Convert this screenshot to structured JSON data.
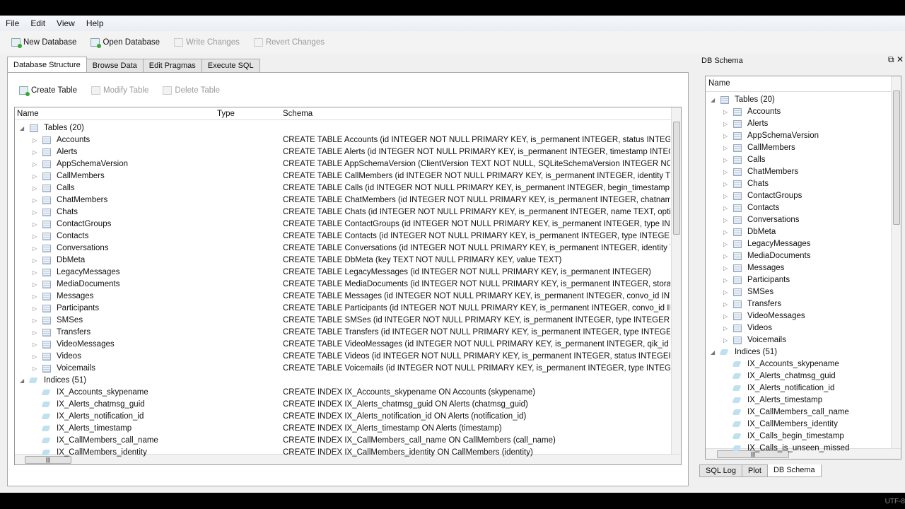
{
  "menu": [
    "File",
    "Edit",
    "View",
    "Help"
  ],
  "toolbar": {
    "new_db": "New Database",
    "open_db": "Open Database",
    "write": "Write Changes",
    "revert": "Revert Changes"
  },
  "tabs": [
    "Database Structure",
    "Browse Data",
    "Edit Pragmas",
    "Execute SQL"
  ],
  "subtoolbar": {
    "create": "Create Table",
    "modify": "Modify Table",
    "delete": "Delete Table"
  },
  "columns": {
    "name": "Name",
    "type": "Type",
    "schema": "Schema"
  },
  "tables_label": "Tables (20)",
  "indices_label": "Indices (51)",
  "tables": [
    {
      "name": "Accounts",
      "schema": "CREATE TABLE Accounts (id INTEGER NOT NULL PRIMARY KEY, is_permanent INTEGER, status INTEGER, pwdc"
    },
    {
      "name": "Alerts",
      "schema": "CREATE TABLE Alerts (id INTEGER NOT NULL PRIMARY KEY, is_permanent INTEGER, timestamp INTEGER, partr"
    },
    {
      "name": "AppSchemaVersion",
      "schema": "CREATE TABLE AppSchemaVersion (ClientVersion TEXT NOT NULL, SQLiteSchemaVersion INTEGER NOT NULL"
    },
    {
      "name": "CallMembers",
      "schema": "CREATE TABLE CallMembers (id INTEGER NOT NULL PRIMARY KEY, is_permanent INTEGER, identity TEXT, disp"
    },
    {
      "name": "Calls",
      "schema": "CREATE TABLE Calls (id INTEGER NOT NULL PRIMARY KEY, is_permanent INTEGER, begin_timestamp INTEGER"
    },
    {
      "name": "ChatMembers",
      "schema": "CREATE TABLE ChatMembers (id INTEGER NOT NULL PRIMARY KEY, is_permanent INTEGER, chatname TEXT, i"
    },
    {
      "name": "Chats",
      "schema": "CREATE TABLE Chats (id INTEGER NOT NULL PRIMARY KEY, is_permanent INTEGER, name TEXT, options INTE"
    },
    {
      "name": "ContactGroups",
      "schema": "CREATE TABLE ContactGroups (id INTEGER NOT NULL PRIMARY KEY, is_permanent INTEGER, type INTEGER, c"
    },
    {
      "name": "Contacts",
      "schema": "CREATE TABLE Contacts (id INTEGER NOT NULL PRIMARY KEY, is_permanent INTEGER, type INTEGER, skypena"
    },
    {
      "name": "Conversations",
      "schema": "CREATE TABLE Conversations (id INTEGER NOT NULL PRIMARY KEY, is_permanent INTEGER, identity TEXT, typ"
    },
    {
      "name": "DbMeta",
      "schema": "CREATE TABLE DbMeta (key TEXT NOT NULL PRIMARY KEY, value TEXT)"
    },
    {
      "name": "LegacyMessages",
      "schema": "CREATE TABLE LegacyMessages (id INTEGER NOT NULL PRIMARY KEY, is_permanent INTEGER)"
    },
    {
      "name": "MediaDocuments",
      "schema": "CREATE TABLE MediaDocuments (id INTEGER NOT NULL PRIMARY KEY, is_permanent INTEGER, storage_docu"
    },
    {
      "name": "Messages",
      "schema": "CREATE TABLE Messages (id INTEGER NOT NULL PRIMARY KEY, is_permanent INTEGER, convo_id INTEGER, ch"
    },
    {
      "name": "Participants",
      "schema": "CREATE TABLE Participants (id INTEGER NOT NULL PRIMARY KEY, is_permanent INTEGER, convo_id INTEGER,"
    },
    {
      "name": "SMSes",
      "schema": "CREATE TABLE SMSes (id INTEGER NOT NULL PRIMARY KEY, is_permanent INTEGER, type INTEGER, outgoing_"
    },
    {
      "name": "Transfers",
      "schema": "CREATE TABLE Transfers (id INTEGER NOT NULL PRIMARY KEY, is_permanent INTEGER, type INTEGER, partner_"
    },
    {
      "name": "VideoMessages",
      "schema": "CREATE TABLE VideoMessages (id INTEGER NOT NULL PRIMARY KEY, is_permanent INTEGER, qik_id BLOB, att"
    },
    {
      "name": "Videos",
      "schema": "CREATE TABLE Videos (id INTEGER NOT NULL PRIMARY KEY, is_permanent INTEGER, status INTEGER, error TEX"
    },
    {
      "name": "Voicemails",
      "schema": "CREATE TABLE Voicemails (id INTEGER NOT NULL PRIMARY KEY, is_permanent INTEGER, type INTEGER, partne"
    }
  ],
  "indices": [
    {
      "name": "IX_Accounts_skypename",
      "schema": "CREATE INDEX IX_Accounts_skypename ON Accounts (skypename)"
    },
    {
      "name": "IX_Alerts_chatmsg_guid",
      "schema": "CREATE INDEX IX_Alerts_chatmsg_guid ON Alerts (chatmsg_guid)"
    },
    {
      "name": "IX_Alerts_notification_id",
      "schema": "CREATE INDEX IX_Alerts_notification_id ON Alerts (notification_id)"
    },
    {
      "name": "IX_Alerts_timestamp",
      "schema": "CREATE INDEX IX_Alerts_timestamp ON Alerts (timestamp)"
    },
    {
      "name": "IX_CallMembers_call_name",
      "schema": "CREATE INDEX IX_CallMembers_call_name ON CallMembers (call_name)"
    },
    {
      "name": "IX_CallMembers_identity",
      "schema": "CREATE INDEX IX_CallMembers_identity ON CallMembers (identity)"
    },
    {
      "name": "IX_Calls_begin_timestamp"
    },
    {
      "name": "IX_Calls_is_unseen_missed"
    }
  ],
  "dock": {
    "title": "DB Schema",
    "column": "Name",
    "tabs": [
      "SQL Log",
      "Plot",
      "DB Schema"
    ],
    "encoding": "UTF-8"
  }
}
